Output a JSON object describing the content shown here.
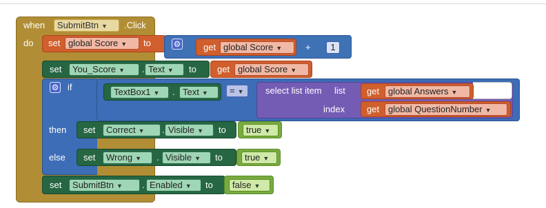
{
  "event": {
    "when_label": "when",
    "component": "SubmitBtn",
    "event_name": ".Click",
    "do_label": "do"
  },
  "stmt1": {
    "set_label": "set",
    "var": "global Score",
    "to_label": "to",
    "get_label": "get",
    "get_var": "global Score",
    "plus_label": "+",
    "number": "1"
  },
  "stmt2": {
    "set_label": "set",
    "component": "You_Score",
    "dot": ".",
    "property": "Text",
    "to_label": "to",
    "get_label": "get",
    "get_var": "global Score"
  },
  "if_block": {
    "if_label": "if",
    "textbox": "TextBox1",
    "dot": ".",
    "property": "Text",
    "op": "=",
    "select_label": "select list item",
    "list_label": "list",
    "get_label1": "get",
    "list_var": "global Answers",
    "index_label": "index",
    "get_label2": "get",
    "index_var": "global QuestionNumber",
    "then_label": "then",
    "then_set_label": "set",
    "then_component": "Correct",
    "then_dot": ".",
    "then_property": "Visible",
    "then_to": "to",
    "then_value": "true",
    "else_label": "else",
    "else_set_label": "set",
    "else_component": "Wrong",
    "else_dot": ".",
    "else_property": "Visible",
    "else_to": "to",
    "else_value": "true"
  },
  "stmt4": {
    "set_label": "set",
    "component": "SubmitBtn",
    "dot": ".",
    "property": "Enabled",
    "to_label": "to",
    "value": "false"
  },
  "colors": {
    "event": "#b18e35",
    "variable": "#d05f2d",
    "component": "#266643",
    "control": "#3c6db6",
    "math": "#3f71b5",
    "list": "#745cb4",
    "logic": "#77ab41"
  },
  "dropdown_icon": "triangle-down-icon",
  "mutator_icon": "gear-icon"
}
